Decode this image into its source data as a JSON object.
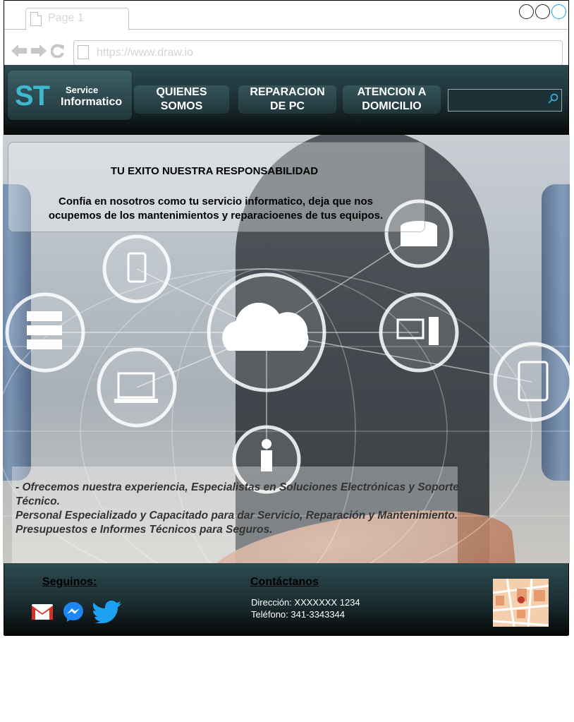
{
  "browser": {
    "tab_label": "Page 1",
    "url": "https://www.draw.io"
  },
  "header": {
    "logo_mark": "ST",
    "logo_line1": "Service",
    "logo_line2": "Informatico",
    "nav": [
      {
        "line1": "QUIENES",
        "line2": "SOMOS"
      },
      {
        "line1": "REPARACION",
        "line2": "DE PC"
      },
      {
        "line1": "ATENCION A",
        "line2": "DOMICILIO"
      }
    ],
    "search_icon": "search-icon"
  },
  "hero": {
    "headline": "TU EXITO NUESTRA RESPONSABILIDAD",
    "sub_line1": "Confia en nosotros como tu servicio informatico, deja que nos",
    "sub_line2": "ocupemos de los  mantenimientos y reparacioenes de tus equipos.",
    "info_1": "- Ofrecemos nuestra experiencia, Especialistas en Soluciones Electrónicas y Soporte Técnico.",
    "info_2": "Personal Especializado y Capacitado para dar Servicio, Reparación y Mantenimiento.",
    "info_3": "Presupuestos e Informes Técnicos para Seguros."
  },
  "footer": {
    "follow_title": "Seguinos:",
    "contact_title": "Contáctanos",
    "address": "Dirección: XXXXXXX 1234",
    "phone": "Teléfono: 341-3343344",
    "social_icons": [
      "gmail-icon",
      "messenger-icon",
      "twitter-icon"
    ],
    "colors": {
      "gmail": "#d93025",
      "messenger": "#1b86f4",
      "twitter": "#1da1f2"
    }
  }
}
